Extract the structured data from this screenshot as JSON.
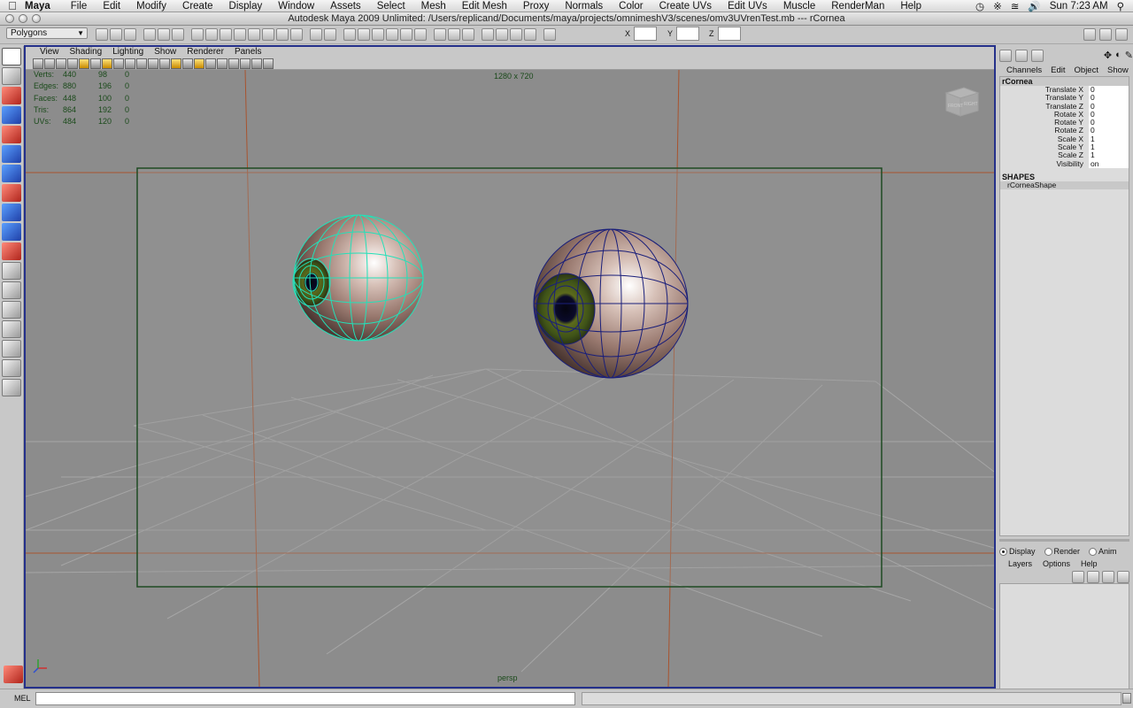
{
  "menubar": {
    "app_name": "Maya",
    "items": [
      "File",
      "Edit",
      "Modify",
      "Create",
      "Display",
      "Window",
      "Assets",
      "Select",
      "Mesh",
      "Edit Mesh",
      "Proxy",
      "Normals",
      "Color",
      "Create UVs",
      "Edit UVs",
      "Muscle",
      "RenderMan",
      "Help"
    ],
    "clock": "Sun 7:23 AM"
  },
  "window": {
    "title": "Autodesk Maya 2009 Unlimited: /Users/replicand/Documents/maya/projects/omnimeshV3/scenes/omv3UVrenTest.mb  ---  rCornea"
  },
  "statusline": {
    "mode": "Polygons",
    "x_label": "X",
    "y_label": "Y",
    "z_label": "Z",
    "x_value": "",
    "y_value": "",
    "z_value": ""
  },
  "viewport": {
    "menu": [
      "View",
      "Shading",
      "Lighting",
      "Show",
      "Renderer",
      "Panels"
    ],
    "resolution": "1280 x 720",
    "camera": "persp",
    "hud": [
      {
        "label": "Verts:",
        "total": "440",
        "selected": "98",
        "components": "0"
      },
      {
        "label": "Edges:",
        "total": "880",
        "selected": "196",
        "components": "0"
      },
      {
        "label": "Faces:",
        "total": "448",
        "selected": "100",
        "components": "0"
      },
      {
        "label": "Tris:",
        "total": "864",
        "selected": "192",
        "components": "0"
      },
      {
        "label": "UVs:",
        "total": "484",
        "selected": "120",
        "components": "0"
      }
    ],
    "viewcube_labels": [
      "FRONT",
      "RIGHT"
    ],
    "colors": {
      "background": "#8c8c8c",
      "grid": "#a6a6a6",
      "resolution_gate": "#1e4a22",
      "camera_lines": "#a8532e",
      "selected_wire": "#24e0b8",
      "active_wire": "#1a1f7a",
      "viewport_border": "#24308a"
    }
  },
  "channelbox": {
    "menu": [
      "Channels",
      "Edit",
      "Object",
      "Show"
    ],
    "object": "rCornea",
    "attributes": [
      {
        "name": "Translate X",
        "value": "0"
      },
      {
        "name": "Translate Y",
        "value": "0"
      },
      {
        "name": "Translate Z",
        "value": "0"
      },
      {
        "name": "Rotate X",
        "value": "0"
      },
      {
        "name": "Rotate Y",
        "value": "0"
      },
      {
        "name": "Rotate Z",
        "value": "0"
      },
      {
        "name": "Scale X",
        "value": "1"
      },
      {
        "name": "Scale Y",
        "value": "1"
      },
      {
        "name": "Scale Z",
        "value": "1"
      },
      {
        "name": "Visibility",
        "value": "on"
      }
    ],
    "shapes_header": "SHAPES",
    "shape": "rCorneaShape"
  },
  "layers": {
    "modes": [
      "Display",
      "Render",
      "Anim"
    ],
    "selected_mode": "Display",
    "menu": [
      "Layers",
      "Options",
      "Help"
    ],
    "nav_prev": "<<",
    "nav_next": ">>"
  },
  "commandline": {
    "label": "MEL",
    "value": ""
  }
}
